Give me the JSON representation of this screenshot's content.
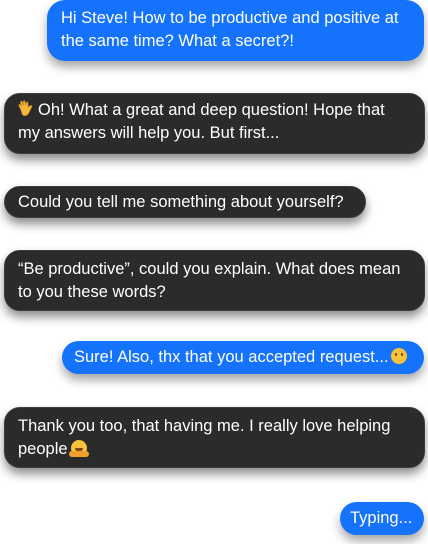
{
  "messages": [
    {
      "sender": "user",
      "text": "Hi Steve! How to be productive and positive at the same time? What a secret?!"
    },
    {
      "sender": "bot",
      "emoji": "waving-hand",
      "text": "Oh! What a great and deep question! Hope that my answers will help you. But first..."
    },
    {
      "sender": "bot",
      "text": "Could you tell me something about yourself?"
    },
    {
      "sender": "bot",
      "text": "“Be productive”, could you explain. What does mean to you these words?"
    },
    {
      "sender": "user",
      "text": "Sure! Also, thx that you accepted request...",
      "emoji": "smiling-face"
    },
    {
      "sender": "bot",
      "text": "Thank you too, that having me. I really love helping people",
      "emoji": "hugging-face"
    },
    {
      "sender": "user",
      "text": "Typing..."
    }
  ],
  "colors": {
    "outgoing_bubble": "#1573fb",
    "incoming_bubble": "#2b2b2b",
    "text": "#ffffff"
  }
}
